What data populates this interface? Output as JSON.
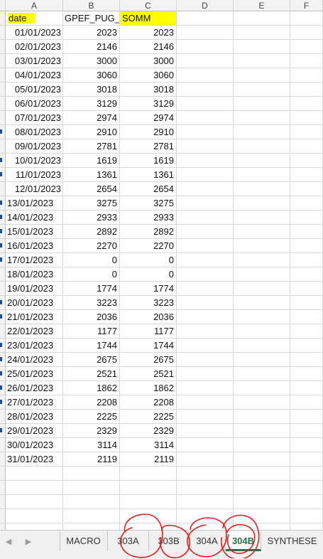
{
  "columns": [
    "A",
    "B",
    "C",
    "D",
    "E",
    "F"
  ],
  "header": {
    "a": "date",
    "b": "GPEF_PUG_T",
    "c": "SOMM"
  },
  "rows": [
    {
      "date": "01/01/2023",
      "b": "2023",
      "c": "2023"
    },
    {
      "date": "02/01/2023",
      "b": "2146",
      "c": "2146"
    },
    {
      "date": "03/01/2023",
      "b": "3000",
      "c": "3000"
    },
    {
      "date": "04/01/2023",
      "b": "3060",
      "c": "3060"
    },
    {
      "date": "05/01/2023",
      "b": "3018",
      "c": "3018"
    },
    {
      "date": "06/01/2023",
      "b": "3129",
      "c": "3129"
    },
    {
      "date": "07/01/2023",
      "b": "2974",
      "c": "2974"
    },
    {
      "date": "08/01/2023",
      "b": "2910",
      "c": "2910"
    },
    {
      "date": "09/01/2023",
      "b": "2781",
      "c": "2781"
    },
    {
      "date": "10/01/2023",
      "b": "1619",
      "c": "1619"
    },
    {
      "date": "11/01/2023",
      "b": "1361",
      "c": "1361"
    },
    {
      "date": "12/01/2023",
      "b": "2654",
      "c": "2654"
    },
    {
      "date": "13/01/2023",
      "b": "3275",
      "c": "3275"
    },
    {
      "date": "14/01/2023",
      "b": "2933",
      "c": "2933"
    },
    {
      "date": "15/01/2023",
      "b": "2892",
      "c": "2892"
    },
    {
      "date": "16/01/2023",
      "b": "2270",
      "c": "2270"
    },
    {
      "date": "17/01/2023",
      "b": "0",
      "c": "0"
    },
    {
      "date": "18/01/2023",
      "b": "0",
      "c": "0"
    },
    {
      "date": "19/01/2023",
      "b": "1774",
      "c": "1774"
    },
    {
      "date": "20/01/2023",
      "b": "3223",
      "c": "3223"
    },
    {
      "date": "21/01/2023",
      "b": "2036",
      "c": "2036"
    },
    {
      "date": "22/01/2023",
      "b": "1177",
      "c": "1177"
    },
    {
      "date": "23/01/2023",
      "b": "1744",
      "c": "1744"
    },
    {
      "date": "24/01/2023",
      "b": "2675",
      "c": "2675"
    },
    {
      "date": "25/01/2023",
      "b": "2521",
      "c": "2521"
    },
    {
      "date": "26/01/2023",
      "b": "1862",
      "c": "1862"
    },
    {
      "date": "27/01/2023",
      "b": "2208",
      "c": "2208"
    },
    {
      "date": "28/01/2023",
      "b": "2225",
      "c": "2225"
    },
    {
      "date": "29/01/2023",
      "b": "2329",
      "c": "2329"
    },
    {
      "date": "30/01/2023",
      "b": "3114",
      "c": "3114"
    },
    {
      "date": "31/01/2023",
      "b": "2119",
      "c": "2119"
    }
  ],
  "sheet_tabs": [
    "MACRO",
    "303A",
    "303B",
    "304A",
    "304B",
    "SYNTHESE"
  ],
  "active_tab": "304B",
  "colors": {
    "highlight": "#ffff00",
    "active_tab": "#217346",
    "annotation": "#e02020"
  },
  "icons": {
    "nav_prev": "left-triangle-icon",
    "nav_next": "right-triangle-icon"
  }
}
